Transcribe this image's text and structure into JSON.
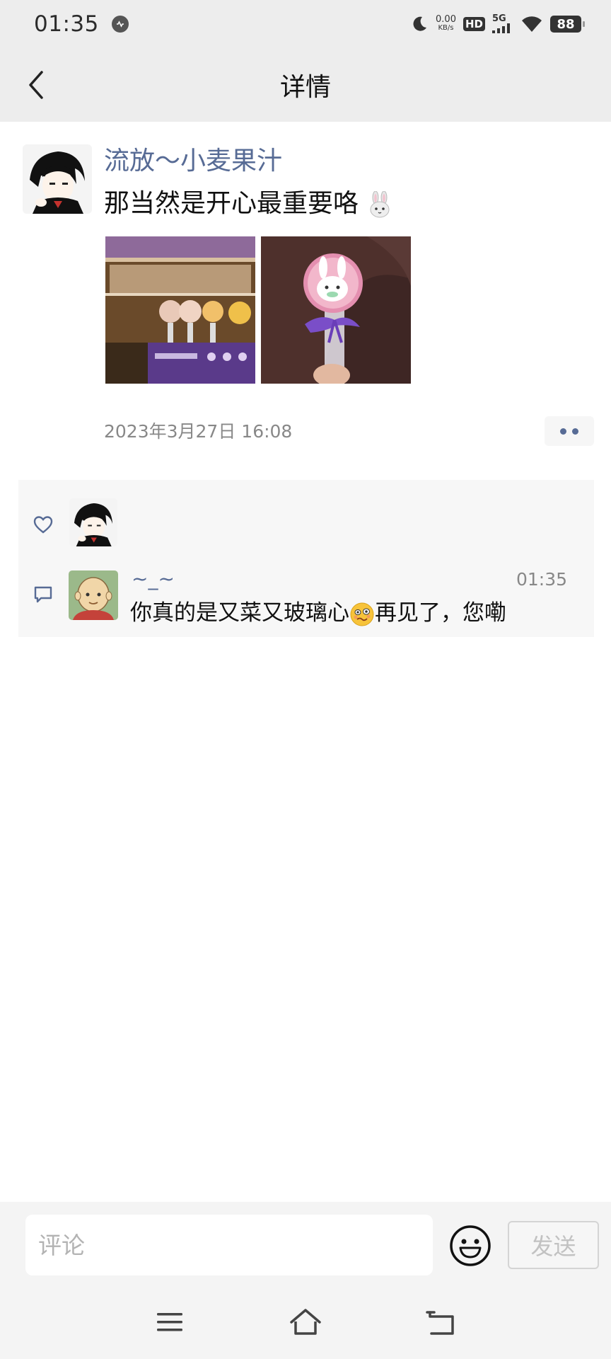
{
  "status_bar": {
    "time": "01:35",
    "net_speed_value": "0.00",
    "net_speed_unit": "KB/s",
    "hd_label": "HD",
    "network_label": "5G",
    "battery": "88",
    "icons": [
      "notification-dot-icon",
      "moon-icon",
      "signal-icon",
      "wifi-icon",
      "battery-icon"
    ]
  },
  "nav": {
    "title": "详情",
    "back_icon": "chevron-left-icon"
  },
  "post": {
    "author": "流放～小麦果汁",
    "text": "那当然是开心最重要咯",
    "timestamp": "2023年3月27日 16:08",
    "images": [
      "photo-of-rabbit-lollipop-display",
      "photo-of-rabbit-lollipop"
    ]
  },
  "interactions": {
    "comment": {
      "name": "~_~",
      "time": "01:35",
      "text_before_emoji": "你真的是又菜又玻璃心",
      "text_after_emoji": "再见了，您嘞"
    }
  },
  "input": {
    "placeholder": "评论",
    "value": "",
    "send_label": "发送"
  },
  "colors": {
    "link_blue": "#576b95",
    "header_bg": "#ededed",
    "box_bg": "#f7f7f7"
  }
}
